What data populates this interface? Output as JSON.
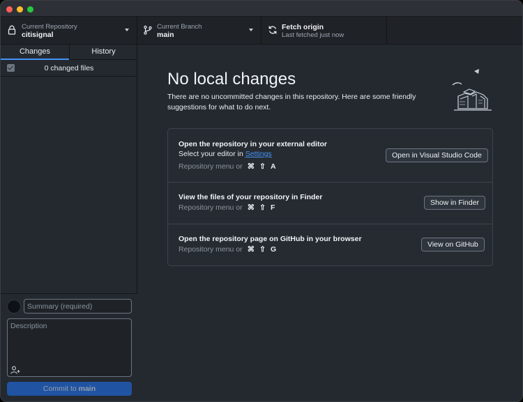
{
  "toolbar": {
    "repository": {
      "label": "Current Repository",
      "value": "citisignal"
    },
    "branch": {
      "label": "Current Branch",
      "value": "main"
    },
    "fetch": {
      "label": "Fetch origin",
      "status": "Last fetched just now"
    }
  },
  "sidebar": {
    "tabs": [
      {
        "label": "Changes",
        "active": true
      },
      {
        "label": "History",
        "active": false
      }
    ],
    "changes_summary": "0 changed files",
    "commit": {
      "summary_placeholder": "Summary (required)",
      "description_placeholder": "Description",
      "button_prefix": "Commit to",
      "button_branch": "main"
    }
  },
  "main": {
    "title": "No local changes",
    "subtitle": "There are no uncommitted changes in this repository. Here are some friendly suggestions for what to do next.",
    "suggestions": [
      {
        "title": "Open the repository in your external editor",
        "subtitle_prefix": "Select your editor in ",
        "subtitle_link": "Settings",
        "shortcut_prefix": "Repository menu or",
        "shortcut_keys": [
          "⌘",
          "⇧",
          "A"
        ],
        "button": "Open in Visual Studio Code"
      },
      {
        "title": "View the files of your repository in Finder",
        "shortcut_prefix": "Repository menu or",
        "shortcut_keys": [
          "⌘",
          "⇧",
          "F"
        ],
        "button": "Show in Finder"
      },
      {
        "title": "Open the repository page on GitHub in your browser",
        "shortcut_prefix": "Repository menu or",
        "shortcut_keys": [
          "⌘",
          "⇧",
          "G"
        ],
        "button": "View on GitHub"
      }
    ]
  },
  "icons": [
    "lock-icon",
    "branch-icon",
    "sync-icon",
    "caret-down-icon",
    "add-coauthor-icon",
    "checkbox-icon"
  ],
  "colors": {
    "accent": "#4493f8",
    "commit_button": "#1f6feb",
    "background": "#24292f"
  }
}
